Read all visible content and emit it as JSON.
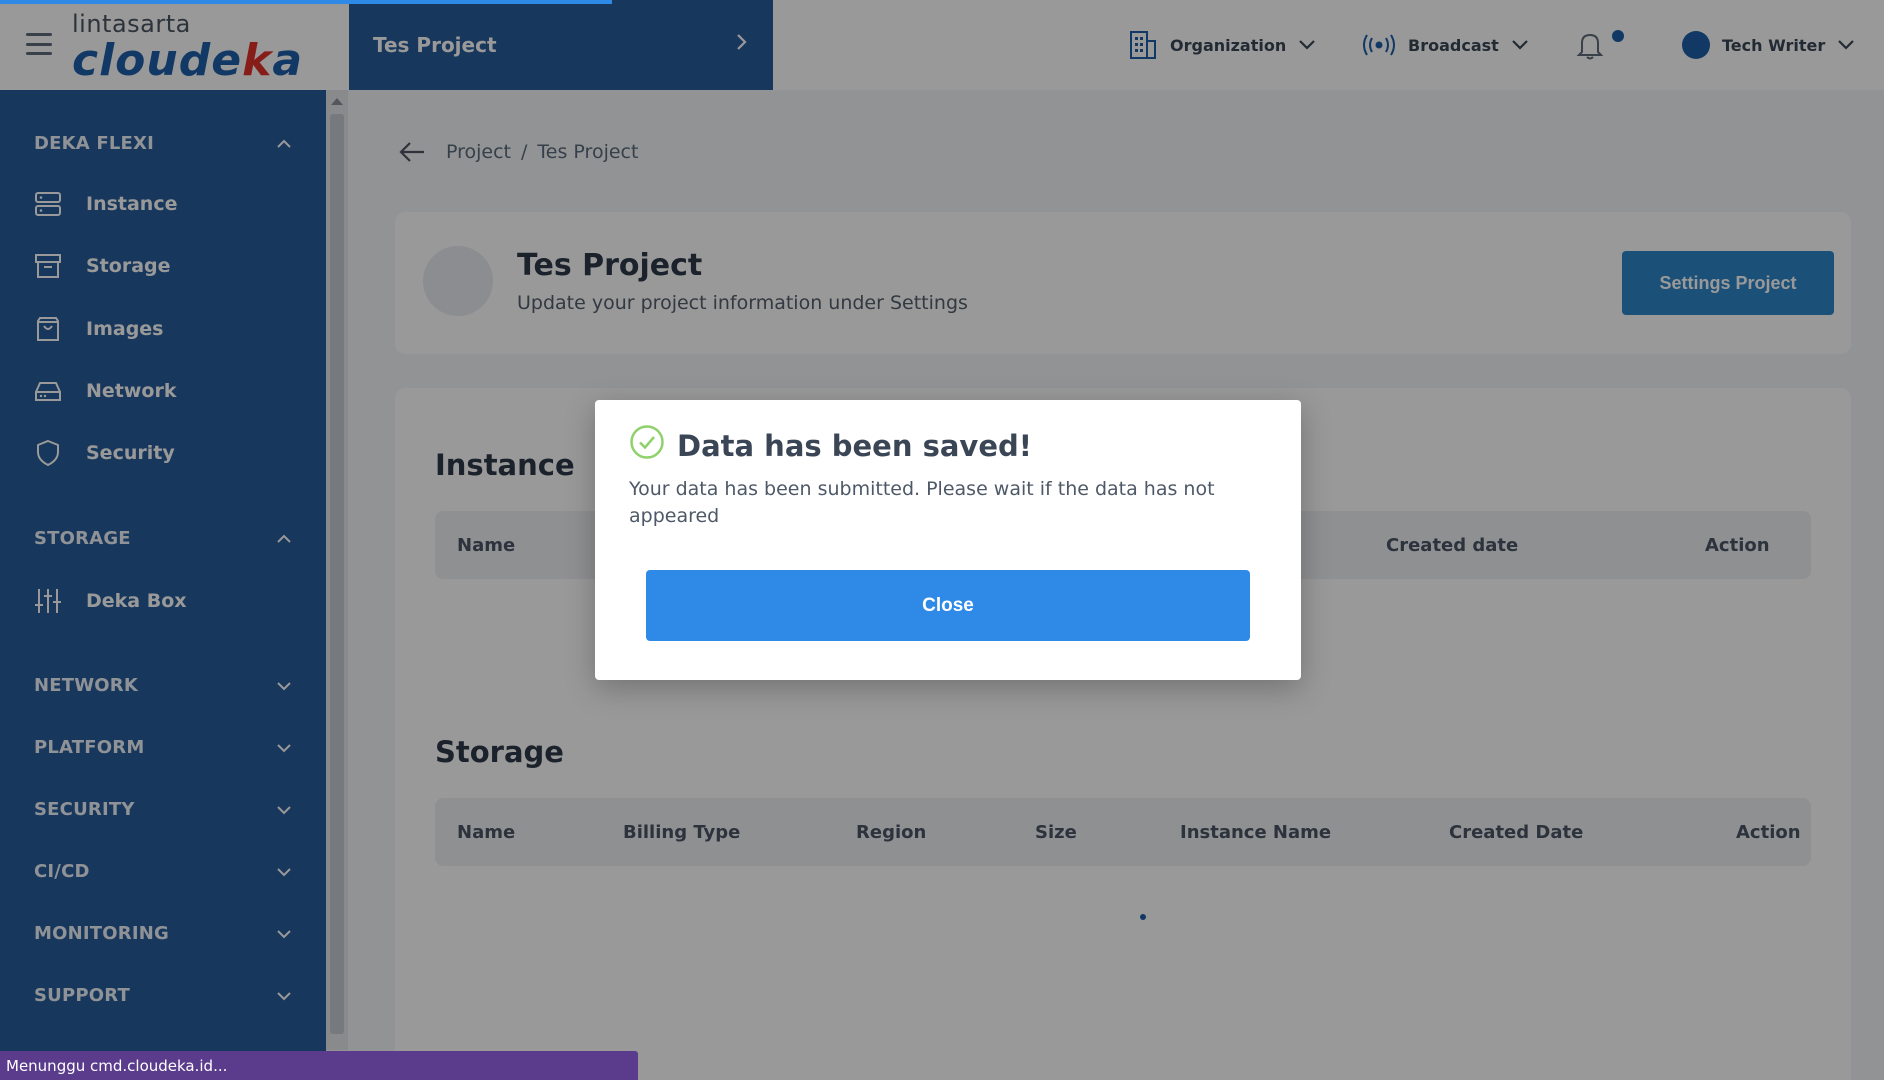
{
  "header": {
    "progress": 0.325,
    "logo": {
      "top": "lintasarta",
      "main_pre": "cloude",
      "main_accent": "k",
      "main_post": "a"
    },
    "project_selector": "Tes Project",
    "organization": "Organization",
    "broadcast": "Broadcast",
    "user": "Tech Writer"
  },
  "sidebar": {
    "sections": {
      "deka_flexi": "DEKA FLEXI",
      "storage": "STORAGE",
      "network": "NETWORK",
      "platform": "PLATFORM",
      "security": "SECURITY",
      "cicd": "CI/CD",
      "monitoring": "MONITORING",
      "support": "SUPPORT"
    },
    "items": {
      "instance": "Instance",
      "storage": "Storage",
      "images": "Images",
      "network": "Network",
      "security": "Security",
      "deka_box": "Deka Box"
    }
  },
  "breadcrumb": {
    "root": "Project",
    "separator": "/",
    "current": "Tes Project"
  },
  "project": {
    "title": "Tes Project",
    "subtitle": "Update your project information under Settings",
    "settings_button": "Settings Project"
  },
  "instance_section": {
    "title": "Instance",
    "columns": {
      "name": "Name",
      "created_date": "Created date",
      "action": "Action"
    }
  },
  "storage_section": {
    "title": "Storage",
    "columns": {
      "name": "Name",
      "billing_type": "Billing Type",
      "region": "Region",
      "size": "Size",
      "instance_name": "Instance Name",
      "created_date": "Created Date",
      "action": "Action"
    }
  },
  "modal": {
    "title": "Data has been saved!",
    "body": "Your data has been submitted. Please wait if the data has not appeared",
    "close_button": "Close"
  },
  "statusbar": {
    "text": "Menunggu cmd.cloudeka.id..."
  },
  "colors": {
    "brand_blue": "#295d99",
    "button_blue": "#2e8ae6",
    "success_green": "#8fd16a",
    "status_purple": "#5a3b8c"
  }
}
